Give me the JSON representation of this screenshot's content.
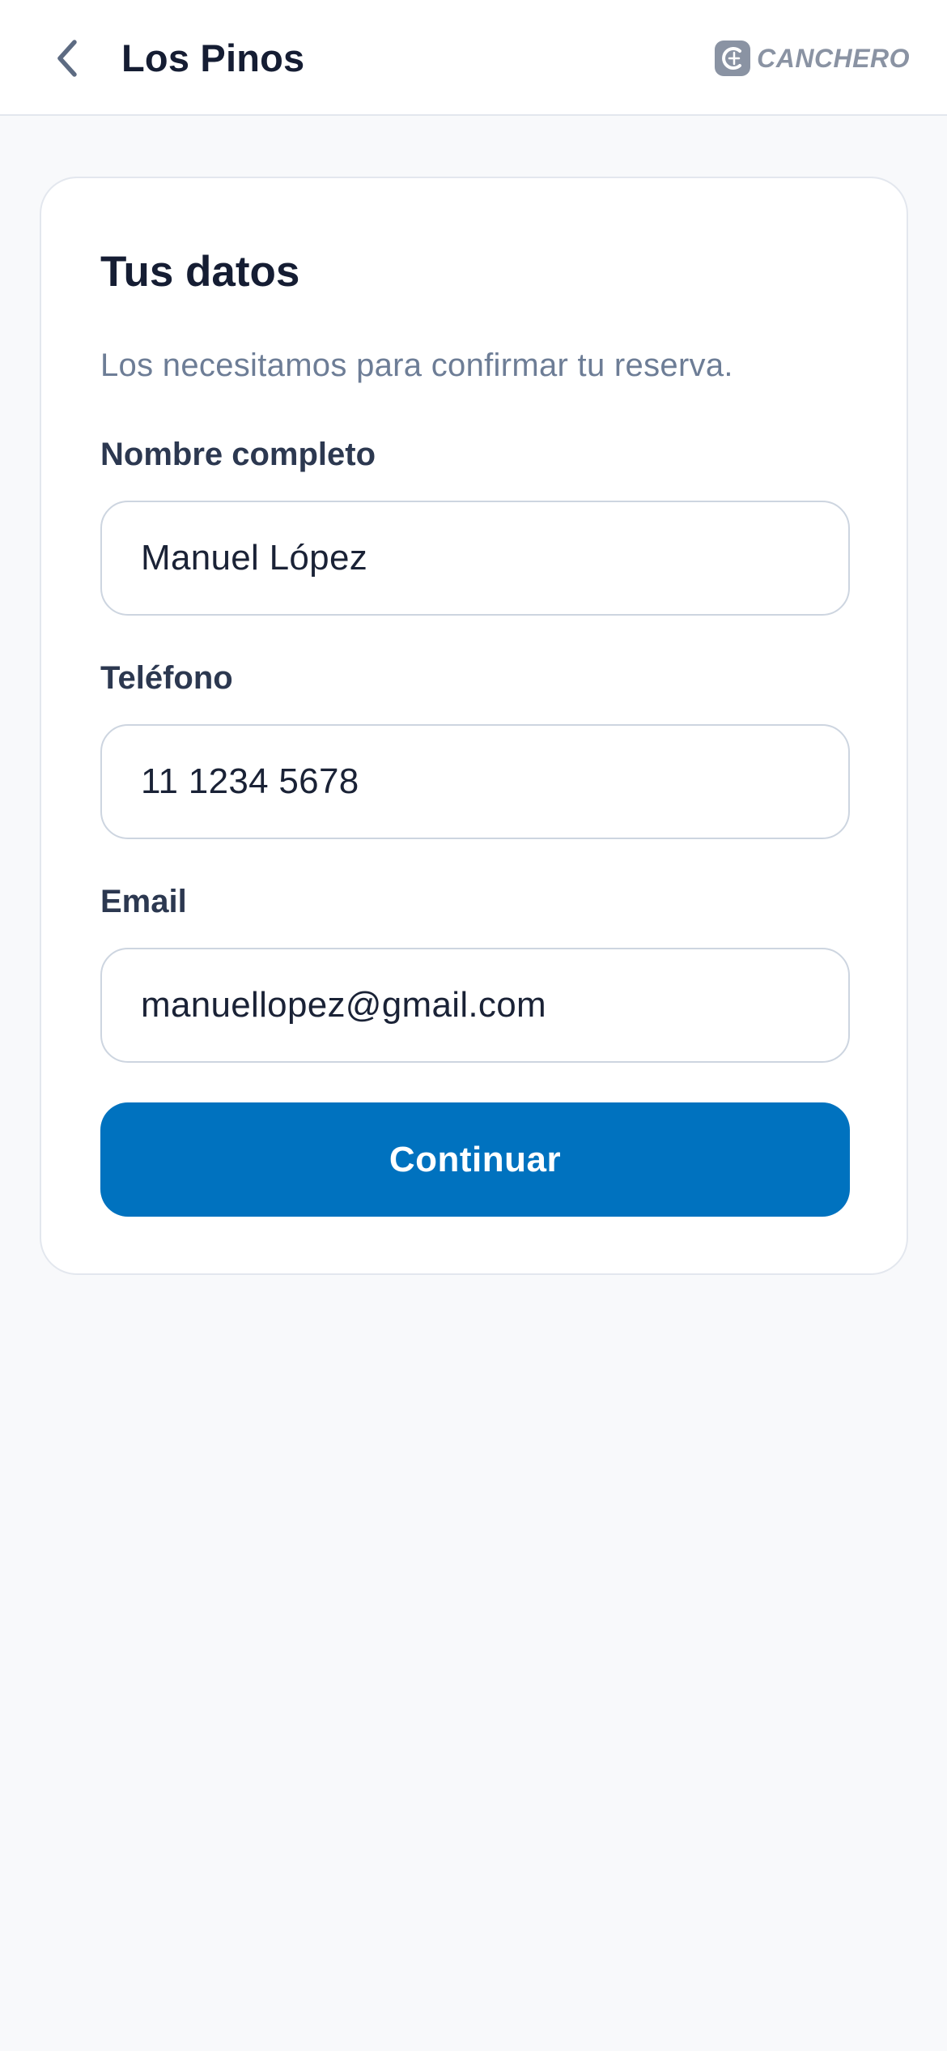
{
  "header": {
    "title": "Los Pinos",
    "back_icon": "chevron-left-icon",
    "brand": {
      "name": "CANCHERO",
      "icon": "canchero-logo-icon",
      "color": "#8a93a3"
    }
  },
  "form": {
    "title": "Tus datos",
    "subtitle": "Los necesitamos para confirmar tu reserva.",
    "fields": [
      {
        "label": "Nombre completo",
        "value": "Manuel López"
      },
      {
        "label": "Teléfono",
        "value": "11 1234 5678"
      },
      {
        "label": "Email",
        "value": "manuellopez@gmail.com"
      }
    ],
    "submit_label": "Continuar"
  },
  "colors": {
    "primary": "#0072bf",
    "background": "#f8f9fb",
    "text_dark": "#151d33",
    "text_muted": "#6d7d96"
  }
}
